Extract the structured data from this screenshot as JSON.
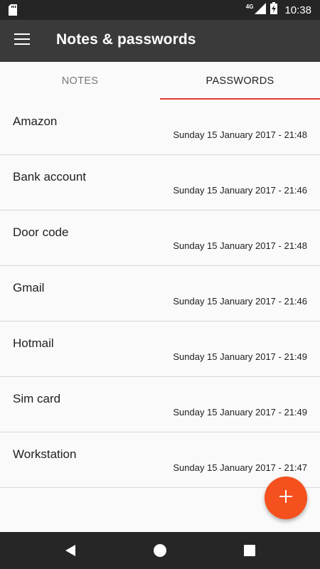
{
  "status_bar": {
    "network": "4G",
    "time": "10:38"
  },
  "app_bar": {
    "title": "Notes & passwords"
  },
  "tabs": [
    {
      "label": "NOTES",
      "active": false
    },
    {
      "label": "PASSWORDS",
      "active": true
    }
  ],
  "entries": [
    {
      "name": "Amazon",
      "date": "Sunday 15 January 2017 - 21:48"
    },
    {
      "name": "Bank account",
      "date": "Sunday 15 January 2017 - 21:46"
    },
    {
      "name": "Door code",
      "date": "Sunday 15 January 2017 - 21:48"
    },
    {
      "name": "Gmail",
      "date": "Sunday 15 January 2017 - 21:46"
    },
    {
      "name": "Hotmail",
      "date": "Sunday 15 January 2017 - 21:49"
    },
    {
      "name": "Sim card",
      "date": "Sunday 15 January 2017 - 21:49"
    },
    {
      "name": "Workstation",
      "date": "Sunday 15 January 2017 - 21:47"
    }
  ],
  "colors": {
    "app_bar": "#3a3a3a",
    "tab_indicator": "#e53935",
    "fab": "#f4511e"
  },
  "icons": {
    "fab": "plus-icon",
    "menu": "hamburger-menu-icon"
  }
}
